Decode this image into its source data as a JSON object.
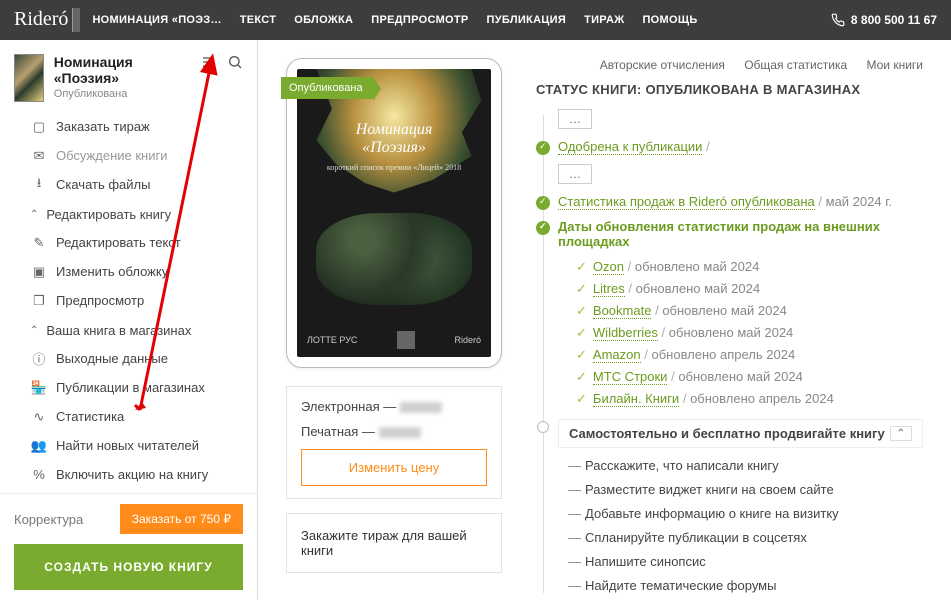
{
  "brand": "Rideró",
  "nav": {
    "n0": "НОМИНАЦИЯ «ПОЭЗ…",
    "n1": "ТЕКСТ",
    "n2": "ОБЛОЖКА",
    "n3": "ПРЕДПРОСМОТР",
    "n4": "ПУБЛИКАЦИЯ",
    "n5": "ТИРАЖ",
    "n6": "ПОМОЩЬ"
  },
  "phone": "8 800 500 11 67",
  "sidebar": {
    "title": "Номинация «Поэзия»",
    "status": "Опубликована",
    "m_order": "Заказать тираж",
    "m_discuss": "Обсуждение книги",
    "m_download": "Скачать файлы",
    "g_edit": "Редактировать книгу",
    "m_edit_text": "Редактировать текст",
    "m_cover": "Изменить обложку",
    "m_preview": "Предпросмотр",
    "g_store": "Ваша книга в магазинах",
    "m_meta": "Выходные данные",
    "m_pubs": "Публикации в магазинах",
    "m_stats": "Статистика",
    "m_readers": "Найти новых читателей",
    "m_promo": "Включить акцию на книгу",
    "proof": "Корректура",
    "proof_btn": "Заказать от 750 ₽",
    "create": "СОЗДАТЬ НОВУЮ КНИГУ"
  },
  "book": {
    "ribbon": "Опубликована",
    "cover_title1": "Номинация",
    "cover_title2": "«Поэзия»",
    "cover_sub": "короткий список премии «Лицей» 2018",
    "pub": "ЛОТТЕ РУС",
    "brand": "Rideró",
    "row_e": "Электронная —",
    "row_p": "Печатная —",
    "btn_price": "Изменить цену",
    "order_tirazh": "Закажите тираж для вашей книги"
  },
  "toplinks": {
    "a": "Авторские отчисления",
    "b": "Общая статистика",
    "c": "Мои книги"
  },
  "status": {
    "title": "СТАТУС КНИГИ: ОПУБЛИКОВАНА В МАГАЗИНАХ",
    "dots": "…",
    "approved": "Одобрена к публикации",
    "stats_pub": "Статистика продаж в Rideró опубликована",
    "stats_date": "май 2024 г.",
    "ext_title": "Даты обновления статистики продаж на внешних площадках",
    "stores": [
      {
        "name": "Ozon",
        "date": "обновлено май 2024"
      },
      {
        "name": "Litres",
        "date": "обновлено май 2024"
      },
      {
        "name": "Bookmate",
        "date": "обновлено май 2024"
      },
      {
        "name": "Wildberries",
        "date": "обновлено май 2024"
      },
      {
        "name": "Amazon",
        "date": "обновлено апрель 2024"
      },
      {
        "name": "МТС Строки",
        "date": "обновлено май 2024"
      },
      {
        "name": "Билайн. Книги",
        "date": "обновлено апрель 2024"
      }
    ],
    "promo_head": "Самостоятельно и бесплатно продвигайте книгу",
    "tips": [
      "Расскажите, что написали книгу",
      "Разместите виджет книги на своем сайте",
      "Добавьте информацию о книге на визитку",
      "Спланируйте публикации в соцсетях",
      "Напишите синопсис",
      "Найдите тематические форумы"
    ]
  }
}
